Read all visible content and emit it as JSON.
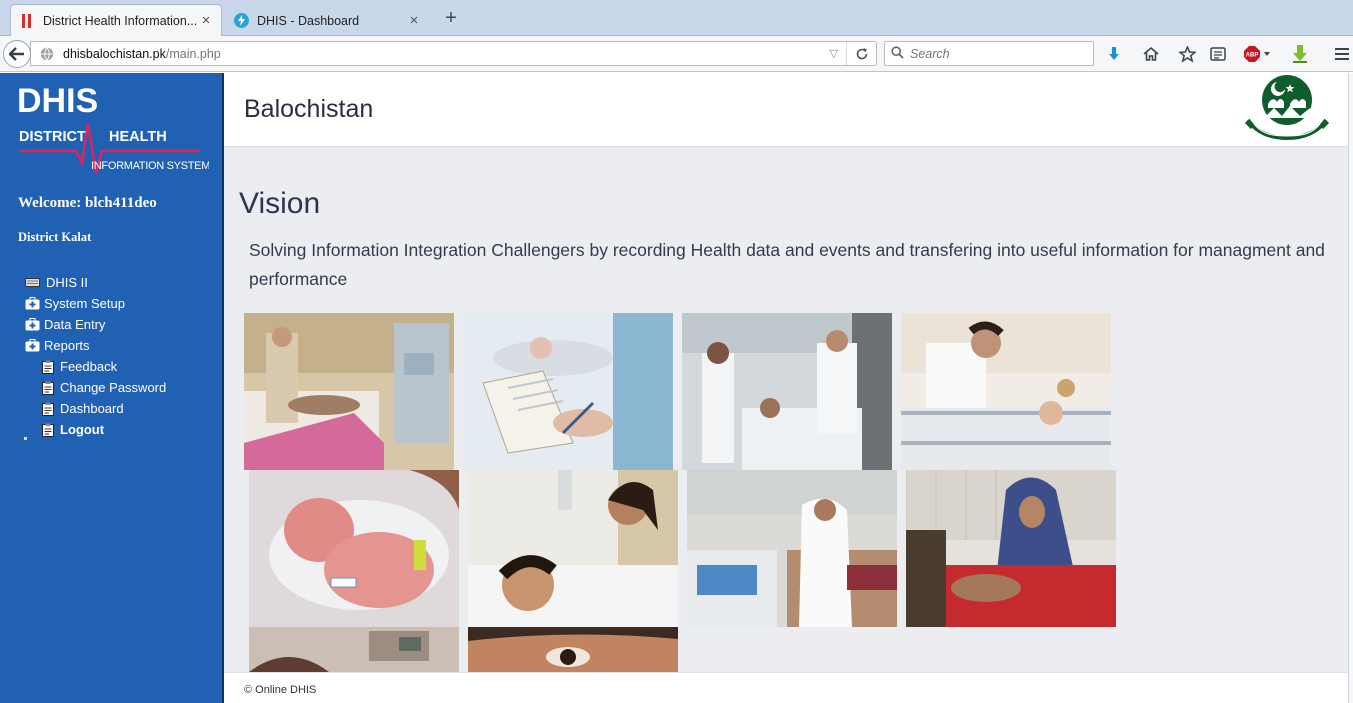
{
  "browser": {
    "tabs": [
      {
        "title": "District Health Information...",
        "close": "×"
      },
      {
        "title": "DHIS - Dashboard",
        "close": "×"
      }
    ],
    "new_tab": "+",
    "url_host": "dhisbalochistan.pk",
    "url_path": "/main.php",
    "search_placeholder": "Search"
  },
  "sidebar": {
    "logo": {
      "line1": "DHIS",
      "district": "DISTRICT",
      "health": "HEALTH",
      "info": "INFORMATION SYSTEM"
    },
    "welcome": "Welcome:  blch411deo",
    "district": "District Kalat",
    "menu": [
      {
        "label": "DHIS II"
      },
      {
        "label": "System Setup"
      },
      {
        "label": "Data Entry"
      },
      {
        "label": "Reports"
      },
      {
        "label": "Feedback"
      },
      {
        "label": "Change Password"
      },
      {
        "label": "Dashboard"
      },
      {
        "label": "Logout"
      }
    ]
  },
  "header": {
    "title": "Balochistan"
  },
  "vision": {
    "title": "Vision",
    "text": "Solving Information Integration Challengers by recording Health data and events and transfering into useful information for managment and performance"
  },
  "photos": [
    {
      "name": "patient-dialysis-photo"
    },
    {
      "name": "nurse-clipboard-photo"
    },
    {
      "name": "doctor-nurse-ward-photo"
    },
    {
      "name": "doctor-child-bed-photo"
    },
    {
      "name": "newborn-baby-photo"
    },
    {
      "name": "nurse-child-photo"
    },
    {
      "name": "crowded-ward-photo"
    },
    {
      "name": "mother-child-photo"
    },
    {
      "name": "hospital-room-photo"
    },
    {
      "name": "child-eye-closeup-photo"
    }
  ],
  "footer": {
    "text": "© Online DHIS"
  },
  "colors": {
    "sidebar": "#2161b3",
    "accent_red": "#e0245e",
    "main_bg": "#ebedf1"
  }
}
